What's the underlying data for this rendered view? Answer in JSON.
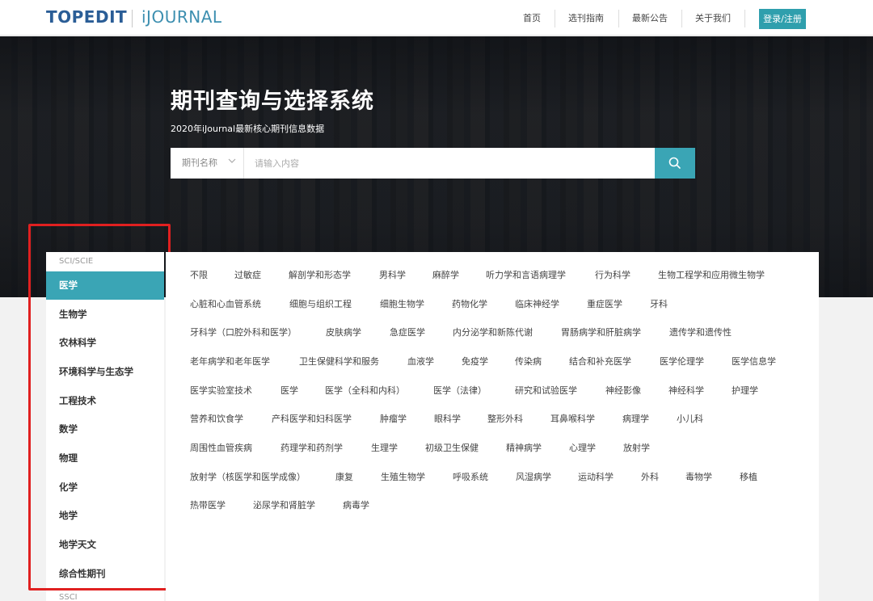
{
  "header": {
    "logo_main": "TOPEDIT",
    "logo_sub": "iJOURNAL",
    "nav": [
      "首页",
      "选刊指南",
      "最新公告",
      "关于我们"
    ],
    "login": "登录/注册"
  },
  "hero": {
    "title": "期刊查询与选择系统",
    "subtitle": "2020年iJournal最新核心期刊信息数据",
    "search": {
      "select_value": "期刊名称",
      "placeholder": "请输入内容"
    }
  },
  "sidebar": {
    "groups": [
      "SCI/SCIE",
      "SSCI"
    ],
    "items": [
      "医学",
      "生物学",
      "农林科学",
      "环境科学与生态学",
      "工程技术",
      "数学",
      "物理",
      "化学",
      "地学",
      "地学天文",
      "综合性期刊"
    ],
    "active_index": 0
  },
  "tags": [
    [
      "不限",
      "过敏症",
      "解剖学和形态学",
      "男科学",
      "麻醉学",
      "听力学和言语病理学",
      "行为科学",
      "生物工程学和应用微生物学"
    ],
    [
      "心脏和心血管系统",
      "细胞与组织工程",
      "细胞生物学",
      "药物化学",
      "临床神经学",
      "重症医学",
      "牙科"
    ],
    [
      "牙科学（口腔外科和医学）",
      "皮肤病学",
      "急症医学",
      "内分泌学和新陈代谢",
      "胃肠病学和肝脏病学",
      "遗传学和遗传性"
    ],
    [
      "老年病学和老年医学",
      "卫生保健科学和服务",
      "血液学",
      "免疫学",
      "传染病",
      "结合和补充医学",
      "医学伦理学",
      "医学信息学"
    ],
    [
      "医学实验室技术",
      "医学",
      "医学（全科和内科）",
      "医学（法律）",
      "研究和试验医学",
      "神经影像",
      "神经科学",
      "护理学"
    ],
    [
      "营养和饮食学",
      "产科医学和妇科医学",
      "肿瘤学",
      "眼科学",
      "整形外科",
      "耳鼻喉科学",
      "病理学",
      "小儿科"
    ],
    [
      "周围性血管疾病",
      "药理学和药剂学",
      "生理学",
      "初级卫生保健",
      "精神病学",
      "心理学",
      "放射学"
    ],
    [
      "放射学（核医学和医学成像）",
      "康复",
      "生殖生物学",
      "呼吸系统",
      "风湿病学",
      "运动科学",
      "外科",
      "毒物学",
      "移植"
    ],
    [
      "热带医学",
      "泌尿学和肾脏学",
      "病毒学"
    ]
  ],
  "colors": {
    "accent": "#3aa5b5",
    "logo": "#2a5d96",
    "highlight_box": "#e02020"
  }
}
